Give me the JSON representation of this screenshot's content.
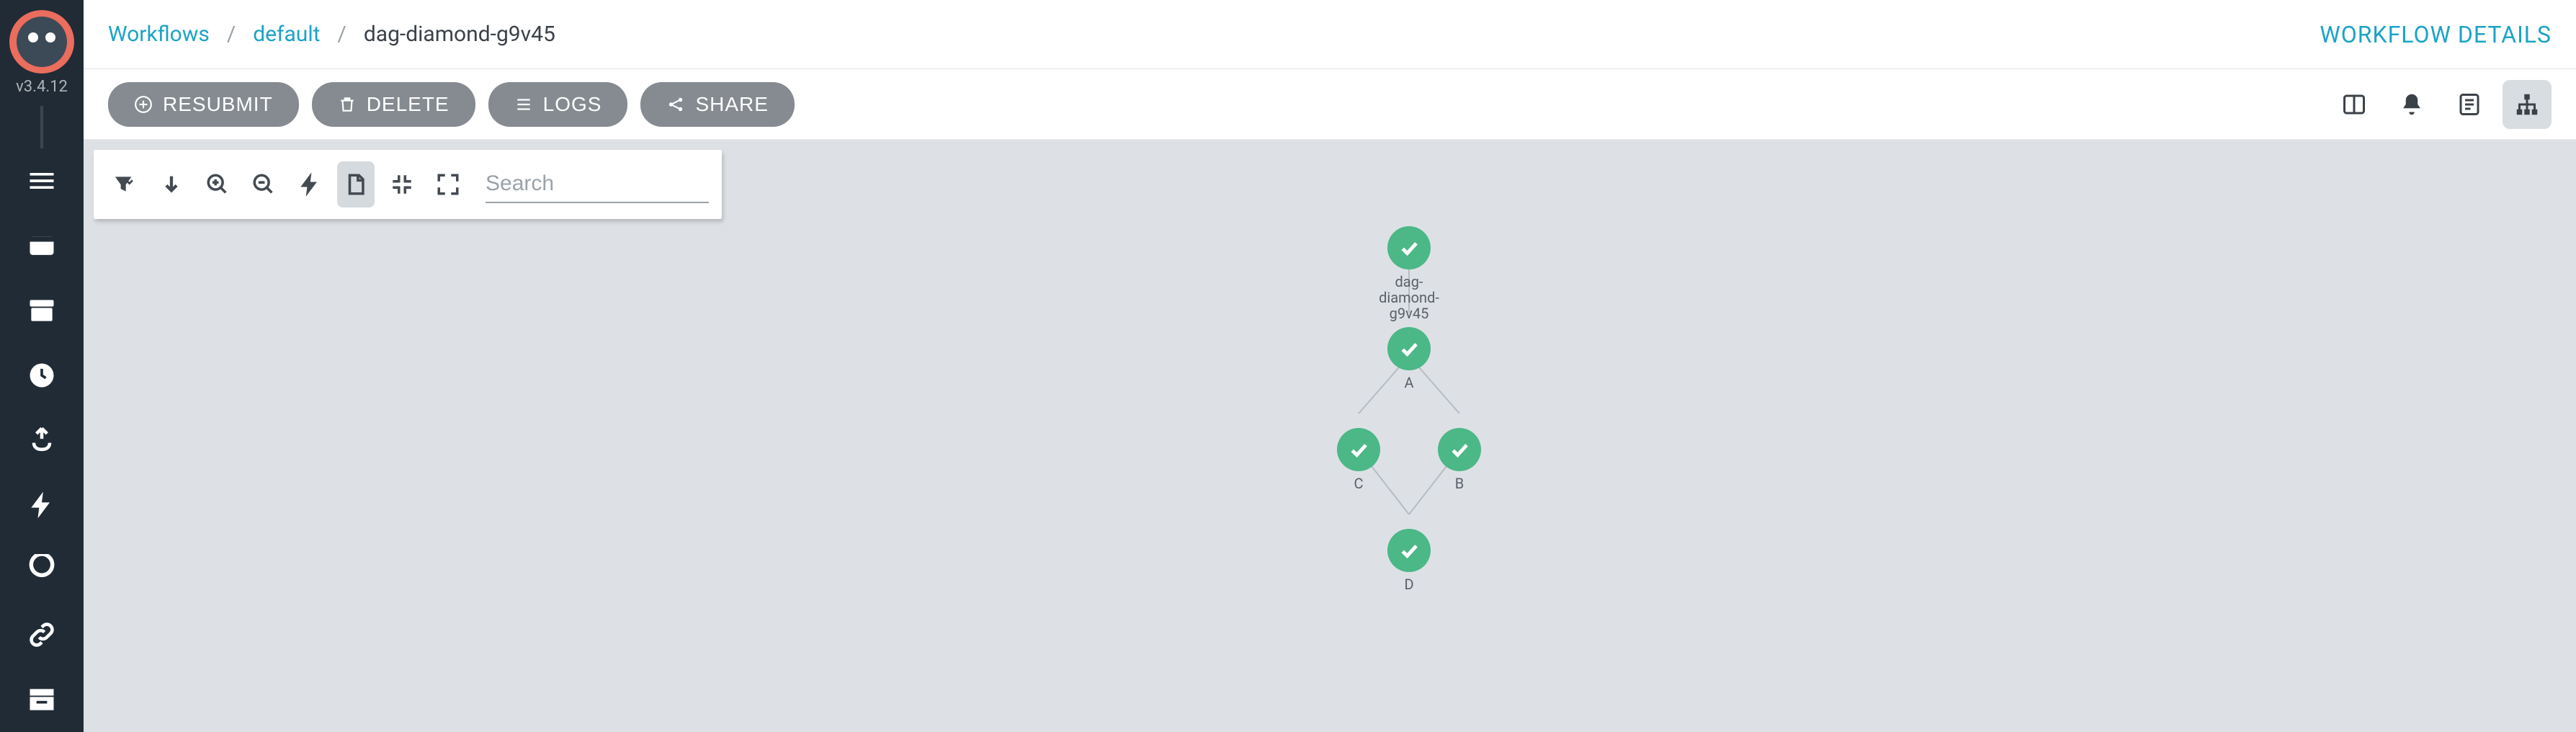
{
  "version": "v3.4.12",
  "breadcrumb": {
    "root": "Workflows",
    "namespace": "default",
    "current": "dag-diamond-g9v45"
  },
  "details_link": "WORKFLOW DETAILS",
  "actions": {
    "resubmit": "RESUBMIT",
    "delete": "DELETE",
    "logs": "LOGS",
    "share": "SHARE"
  },
  "toolbar": {
    "search_placeholder": "Search"
  },
  "graph": {
    "root": {
      "label": "dag-diamond-\ng9v45"
    },
    "a": {
      "label": "A"
    },
    "b": {
      "label": "B"
    },
    "c": {
      "label": "C"
    },
    "d": {
      "label": "D"
    }
  }
}
